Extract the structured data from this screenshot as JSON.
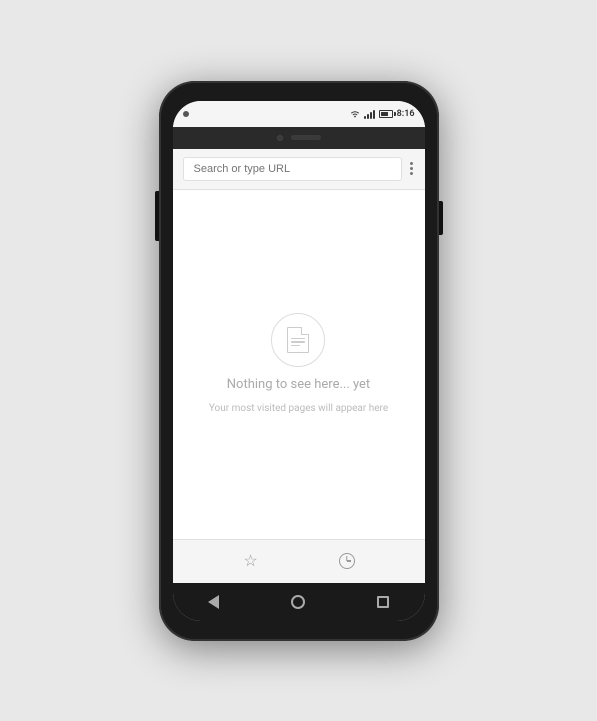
{
  "status_bar": {
    "time": "8:16",
    "signal_label": "signal",
    "wifi_label": "wifi",
    "battery_label": "battery"
  },
  "url_bar": {
    "placeholder": "Search or type URL",
    "menu_label": "More options"
  },
  "empty_state": {
    "title": "Nothing to see here... yet",
    "subtitle": "Your most visited pages will appear here"
  },
  "nav_bar": {
    "back_label": "Back",
    "home_label": "Home",
    "recents_label": "Recent apps"
  },
  "toolbar": {
    "bookmarks_label": "Bookmarks",
    "history_label": "History"
  },
  "colors": {
    "phone_body": "#1a1a1a",
    "screen_bg": "#ffffff",
    "status_bar_bg": "#f5f5f5",
    "url_bar_bg": "#f5f5f5",
    "nav_bar_bg": "#1a1a1a",
    "icon_color": "#cccccc",
    "empty_text": "#aaaaaa"
  }
}
